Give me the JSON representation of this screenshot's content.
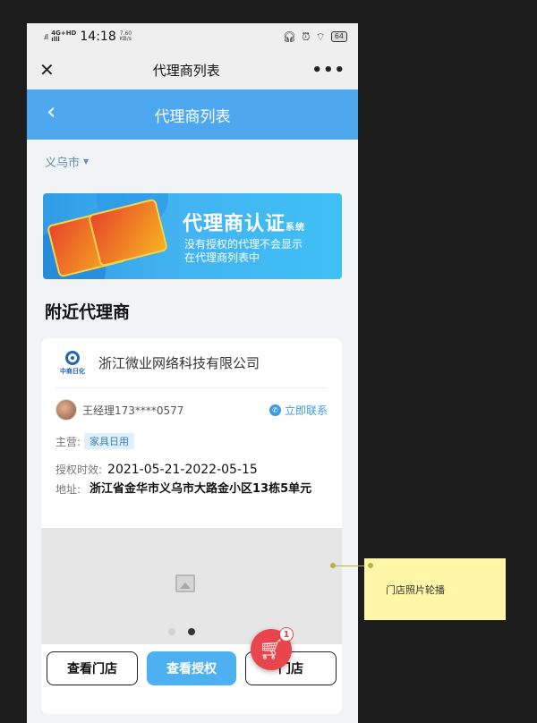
{
  "status_bar": {
    "signal": ".ıll",
    "net_top": "4G+HD",
    "net_bottom": "ılll",
    "time": "14:18",
    "speed_value": "7.60",
    "speed_unit": "KB/s",
    "icons": [
      "headphones-icon",
      "alarm-icon",
      "wifi-icon"
    ],
    "battery": "64"
  },
  "wechat_bar": {
    "close": "✕",
    "title": "代理商列表",
    "more": "•••"
  },
  "app_bar": {
    "back": "‹",
    "title": "代理商列表"
  },
  "city_filter": {
    "city": "义乌市",
    "caret": "▼"
  },
  "banner": {
    "title": "代理商认证",
    "title_suffix": "系统",
    "subtitle_line1": "没有授权的代理不会显示",
    "subtitle_line2": "在代理商列表中"
  },
  "section": {
    "title": "附近代理商"
  },
  "agent_card": {
    "logo_text": "中商日化",
    "company": "浙江微业网络科技有限公司",
    "manager": "王经理173****0577",
    "contact_label": "立即联系",
    "main_label": "主营:",
    "main_tag": "家具日用",
    "period_label": "授权时效:",
    "period_value": "2021-05-21-2022-05-15",
    "address_label": "地址:",
    "address_value": "浙江省金华市义乌市大路金小区13栋5单元",
    "gallery_dots": 2,
    "gallery_active_index": 1,
    "buttons": {
      "view_store": "查看门店",
      "view_auth": "查看授权",
      "store_third": "门店"
    }
  },
  "cart": {
    "icon": "cart-icon",
    "badge": "1"
  },
  "annotation": {
    "note": "门店照片轮播"
  },
  "colors": {
    "primary_blue": "#4da8ef",
    "accent_red": "#e9454c",
    "note_yellow": "#fff6a8"
  }
}
